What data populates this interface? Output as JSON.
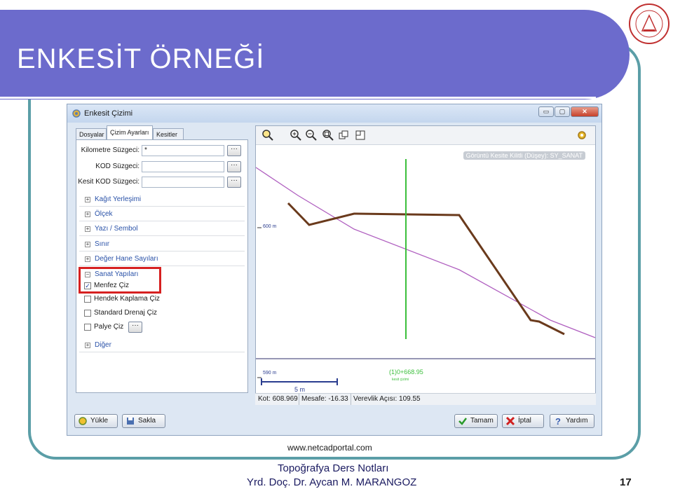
{
  "slide": {
    "title": "ENKESİT ÖRNEĞİ",
    "source_url": "www.netcadportal.com",
    "footer_line1": "Topoğrafya Ders Notları",
    "footer_line2": "Yrd. Doç. Dr. Aycan M. MARANGOZ",
    "page_number": "17",
    "colors": {
      "header": "#6c6bcc",
      "frame": "#5b9ea7",
      "highlight": "#d62020"
    }
  },
  "window": {
    "title": "Enkesit Çizimi",
    "controls": {
      "minimize": "▭",
      "maximize": "▢",
      "close": "✕"
    },
    "tabs": [
      {
        "label": "Dosyalar",
        "active": false
      },
      {
        "label": "Çizim Ayarları",
        "active": true
      },
      {
        "label": "Kesitler",
        "active": false
      }
    ],
    "filters": [
      {
        "label": "Kilometre Süzgeci:",
        "value": "*"
      },
      {
        "label": "KOD Süzgeci:",
        "value": ""
      },
      {
        "label": "Kesit KOD Süzgeci:",
        "value": ""
      }
    ],
    "browse_label": "···",
    "groups": [
      {
        "label": "Kağıt Yerleşimi",
        "expanded": false
      },
      {
        "label": "Ölçek",
        "expanded": false
      },
      {
        "label": "Yazı / Sembol",
        "expanded": false
      },
      {
        "label": "Sınır",
        "expanded": false
      },
      {
        "label": "Değer Hane Sayıları",
        "expanded": false
      },
      {
        "label": "Sanat Yapıları",
        "expanded": true
      },
      {
        "label": "Diğer",
        "expanded": false
      }
    ],
    "sanat_items": [
      {
        "label": "Menfez Çiz",
        "checked": true
      },
      {
        "label": "Hendek Kaplama Çiz",
        "checked": false
      },
      {
        "label": "Standard Drenaj  Çiz",
        "checked": false
      },
      {
        "label": "Palye Çiz",
        "checked": false
      }
    ],
    "viewer": {
      "lock_badge": "Görüntü Kesite Kilitli (Düşey): SY_SANAT",
      "elev_top_label": "600 m",
      "elev_bottom_label": "590 m",
      "station_label": "(1)0+668.95",
      "station_sub": "kesit çizimi",
      "scale_label": "5 m",
      "tools": [
        "zoom-select-icon",
        "zoom-in-icon",
        "zoom-out-icon",
        "zoom-window-icon",
        "copy-icon",
        "fit-icon"
      ]
    },
    "status": {
      "kot": "Kot: 608.969",
      "mesafe": "Mesafe: -16.33",
      "verevlik": "Verevlik Açısı: 109.55"
    },
    "buttons": {
      "yukle": "Yükle",
      "sakla": "Sakla",
      "tamam": "Tamam",
      "iptal": "İptal",
      "yardim": "Yardım"
    }
  }
}
